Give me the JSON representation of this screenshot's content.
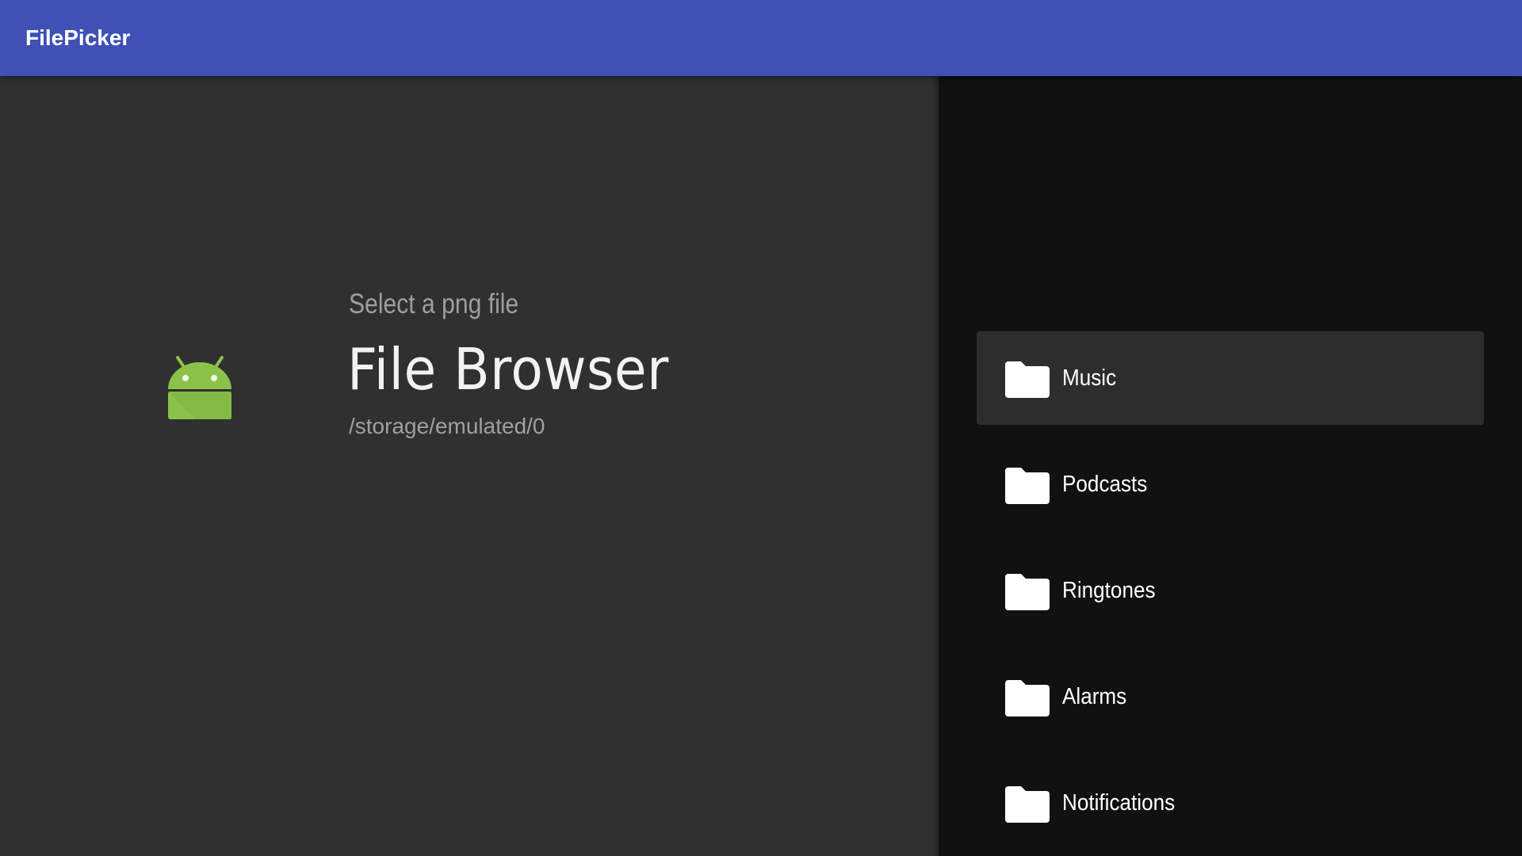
{
  "app_bar": {
    "title": "FilePicker",
    "color": "#3F51B5"
  },
  "header": {
    "subtitle": "Select a png file",
    "title": "File Browser",
    "path": "/storage/emulated/0",
    "logo_icon": "android-icon",
    "logo_color": "#8BC34A"
  },
  "folders": [
    {
      "label": "Music",
      "icon": "folder-icon",
      "focused": true
    },
    {
      "label": "Podcasts",
      "icon": "folder-icon",
      "focused": false
    },
    {
      "label": "Ringtones",
      "icon": "folder-icon",
      "focused": false
    },
    {
      "label": "Alarms",
      "icon": "folder-icon",
      "focused": false
    },
    {
      "label": "Notifications",
      "icon": "folder-icon",
      "focused": false
    }
  ]
}
